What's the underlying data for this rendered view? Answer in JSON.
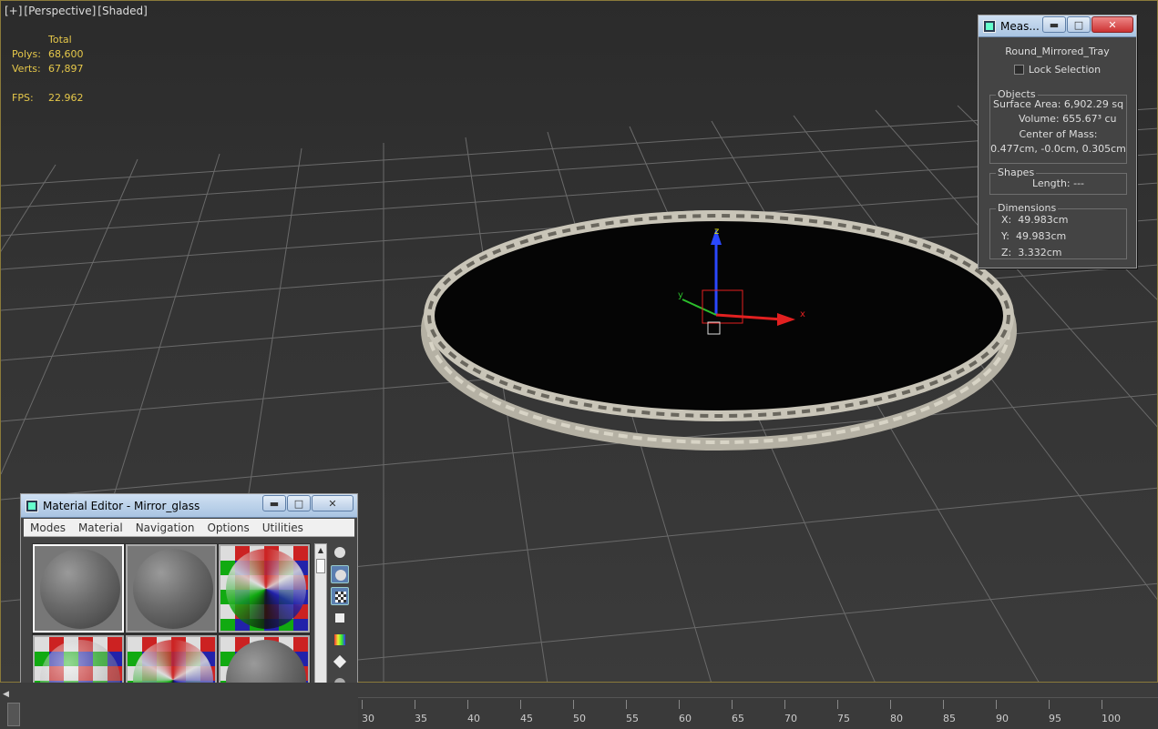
{
  "viewport": {
    "labels": [
      "[+]",
      "[Perspective]",
      "[Shaded]"
    ],
    "stats": {
      "header": "Total",
      "polys_label": "Polys:",
      "polys": "68,600",
      "verts_label": "Verts:",
      "verts": "67,897",
      "fps_label": "FPS:",
      "fps": "22.962"
    },
    "gizmo": {
      "x": "x",
      "y": "y",
      "z": "z"
    }
  },
  "measure": {
    "title": "Meas...",
    "object_name": "Round_Mirrored_Tray",
    "lock_label": "Lock Selection",
    "objects_title": "Objects",
    "surface_area": "Surface Area: 6,902.29 sq",
    "volume": "Volume: 655.67³ cu",
    "com_label": "Center of Mass:",
    "com_value": "0.477cm, -0.0cm, 0.305cm",
    "shapes_title": "Shapes",
    "length": "Length: ---",
    "dimensions_title": "Dimensions",
    "dim_x_label": "X:",
    "dim_x": "49.983cm",
    "dim_y_label": "Y:",
    "dim_y": "49.983cm",
    "dim_z_label": "Z:",
    "dim_z": "3.332cm"
  },
  "material_editor": {
    "title": "Material Editor - Mirror_glass",
    "menu": [
      "Modes",
      "Material",
      "Navigation",
      "Options",
      "Utilities"
    ]
  },
  "timeline": {
    "ticks": [
      "30",
      "35",
      "40",
      "45",
      "50",
      "55",
      "60",
      "65",
      "70",
      "75",
      "80",
      "85",
      "90",
      "95",
      "100"
    ]
  },
  "colors": {
    "stats": "#e6c84a",
    "axis_x": "#e22020",
    "axis_y": "#2bbf2b",
    "axis_z": "#2a48ff"
  }
}
